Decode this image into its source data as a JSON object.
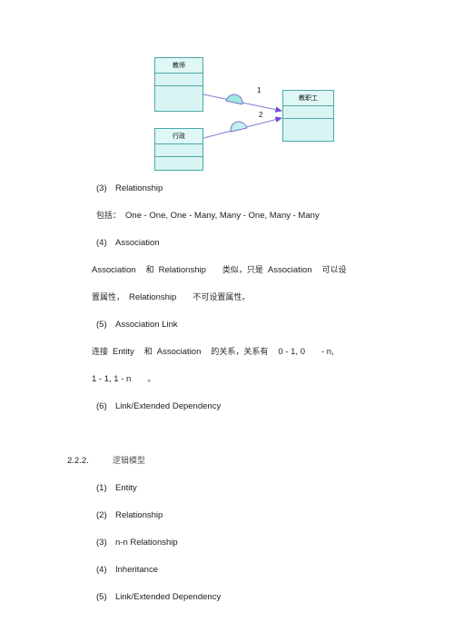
{
  "diagram": {
    "name": "uml-class-diagram",
    "boxes": [
      {
        "id": "teacher",
        "title": "教师",
        "rows": 2
      },
      {
        "id": "admin",
        "title": "行政",
        "rows": 2
      },
      {
        "id": "staff",
        "title": "教职工",
        "rows": 3
      }
    ],
    "multiplicity_labels": [
      "1",
      "2"
    ],
    "colors": {
      "box_fill": "#d9f5f3",
      "box_border": "#4aa8a8",
      "connector": "#8a7fd4",
      "arrow": "#6a4fd0",
      "semicircle_fill": "#9fe8e4"
    }
  },
  "content": {
    "items": [
      {
        "num": "(3)",
        "label": "Relationship"
      },
      {
        "num": "(4)",
        "label": "Association"
      },
      {
        "num": "(5)",
        "label": "Association Link"
      },
      {
        "num": "(6)",
        "label": "Link/Extended Dependency"
      }
    ],
    "relationship_note": {
      "prefix": "包括：",
      "values": "One - One, One - Many, Many - One, Many - Many"
    },
    "association_note": {
      "p1_a": "Association",
      "p1_b": "和",
      "p1_c": "Relationship",
      "p1_d": "类似，只是",
      "p1_e": "Association",
      "p1_f": "可以设",
      "p2_a": "置属性，",
      "p2_b": "Relationship",
      "p2_c": "不可设置属性。"
    },
    "association_link_note": {
      "l1_a": "连接",
      "l1_b": "Entity",
      "l1_c": "和",
      "l1_d": "Association",
      "l1_e": "的关系，关系有",
      "l1_f": "0 - 1, 0",
      "l1_g": "- n,",
      "l2_a": "1 - 1, 1 - n",
      "l2_b": "。"
    }
  },
  "section": {
    "number": "2.2.2.",
    "title": "逻辑模型",
    "items": [
      {
        "num": "(1)",
        "label": "Entity"
      },
      {
        "num": "(2)",
        "label": "Relationship"
      },
      {
        "num": "(3)",
        "label": "n-n Relationship"
      },
      {
        "num": "(4)",
        "label": "Inheritance"
      },
      {
        "num": "(5)",
        "label": "Link/Extended Dependency"
      }
    ]
  }
}
